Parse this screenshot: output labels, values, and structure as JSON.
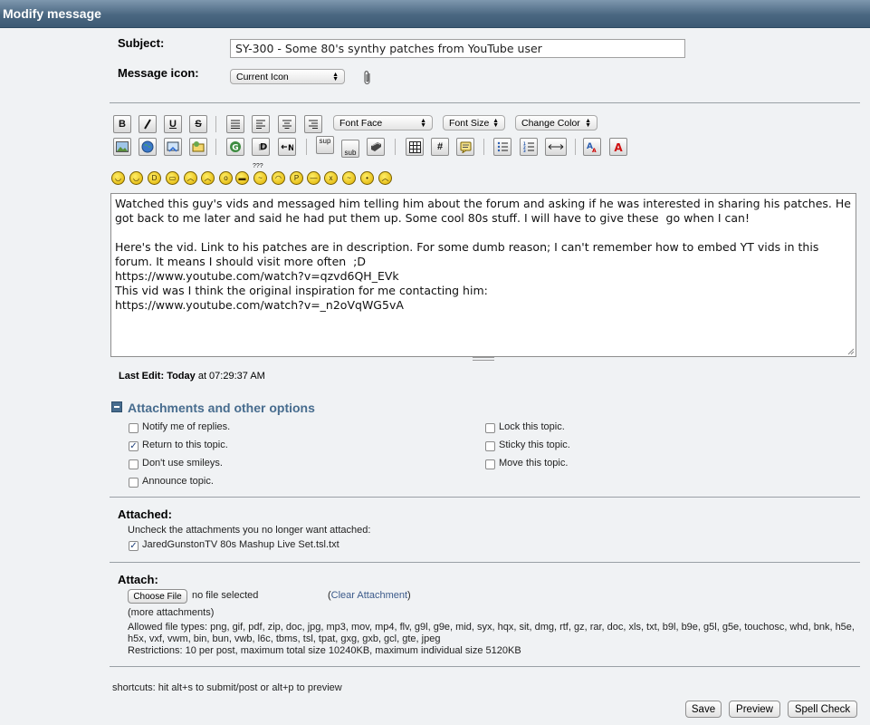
{
  "window": {
    "title": "Modify message"
  },
  "form": {
    "subject_label": "Subject:",
    "subject_value": "SY-300 - Some 80's synthy patches from YouTube user",
    "icon_label": "Message icon:",
    "icon_value": "Current Icon"
  },
  "toolbar": {
    "bold": "B",
    "font_face": "Font Face",
    "font_size": "Font Size",
    "change_color": "Change Color",
    "sup": "sup",
    "sub": "sub",
    "hash": "#"
  },
  "smileys_extra": "???",
  "message_body": "Watched this guy's vids and messaged him telling him about the forum and asking if he was interested in sharing his patches. He got back to me later and said he had put them up. Some cool 80s stuff. I will have to give these  go when I can!\n\nHere's the vid. Link to his patches are in description. For some dumb reason; I can't remember how to embed YT vids in this forum. It means I should visit more often  ;D\nhttps://www.youtube.com/watch?v=qzvd6QH_EVk\nThis vid was I think the original inspiration for me contacting him:\nhttps://www.youtube.com/watch?v=_n2oVqWG5vA",
  "last_edit": {
    "label": "Last Edit:",
    "day": "Today",
    "rest": " at 07:29:37 AM"
  },
  "options": {
    "title": "Attachments and other options",
    "left": [
      {
        "label": "Notify me of replies.",
        "checked": false
      },
      {
        "label": "Return to this topic.",
        "checked": true
      },
      {
        "label": "Don't use smileys.",
        "checked": false
      },
      {
        "label": "Announce topic.",
        "checked": false
      }
    ],
    "right": [
      {
        "label": "Lock this topic.",
        "checked": false
      },
      {
        "label": "Sticky this topic.",
        "checked": false
      },
      {
        "label": "Move this topic.",
        "checked": false
      }
    ]
  },
  "attached": {
    "title": "Attached:",
    "hint": "Uncheck the attachments you no longer want attached:",
    "file": "JaredGunstonTV 80s Mashup Live Set.tsl.txt"
  },
  "attach": {
    "title": "Attach:",
    "choose_file": "Choose File",
    "no_file": "no file selected",
    "clear_open": "(",
    "clear_link": "Clear Attachment",
    "clear_close": ")",
    "more": "(more attachments)",
    "allowed": "Allowed file types: png, gif, pdf, zip, doc, jpg, mp3, mov, mp4, flv, g9l, g9e, mid, syx, hqx, sit, dmg, rtf, gz, rar, doc, xls, txt, b9l, b9e, g5l, g5e, touchosc, whd, bnk, h5e, h5x, vxf, vwm, bin, bun, vwb, l6c, tbms, tsl, tpat, gxg, gxb, gcl, gte, jpeg",
    "restrictions": "Restrictions: 10 per post, maximum total size 10240KB, maximum individual size 5120KB"
  },
  "shortcuts": "shortcuts: hit alt+s to submit/post or alt+p to preview",
  "buttons": {
    "save": "Save",
    "preview": "Preview",
    "spell": "Spell Check"
  }
}
